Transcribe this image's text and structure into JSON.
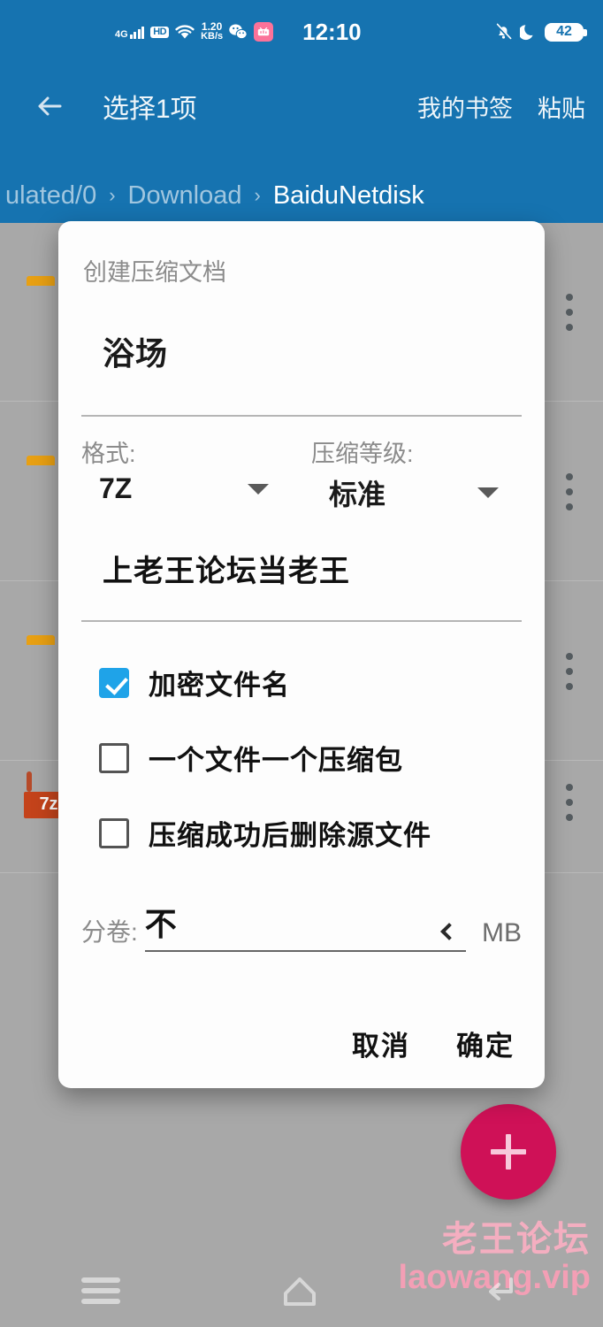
{
  "statusbar": {
    "network_label": "4G",
    "hd_label": "HD",
    "speed_value": "1.20",
    "speed_unit": "KB/s",
    "icons": [
      "signal-4g-icon",
      "hd-icon",
      "wifi-icon",
      "network-speed",
      "wechat-icon",
      "bilibili-icon"
    ],
    "time": "12:10",
    "right_icons": [
      "bell-muted-icon",
      "moon-dnd-icon"
    ],
    "battery_level": "42"
  },
  "toolbar": {
    "back_icon": "back-arrow-icon",
    "title": "选择1项",
    "actions": [
      {
        "label": "我的书签"
      },
      {
        "label": "粘贴"
      }
    ]
  },
  "breadcrumb": {
    "separator": "›",
    "items": [
      {
        "label": "ulated/0",
        "current": false
      },
      {
        "label": "Download",
        "current": false
      },
      {
        "label": "BaiduNetdisk",
        "current": true
      }
    ]
  },
  "filelist": {
    "rows": [
      {
        "icon": "folder-icon",
        "menu": "overflow-menu-icon"
      },
      {
        "icon": "folder-icon",
        "menu": "overflow-menu-icon"
      },
      {
        "icon": "folder-icon",
        "menu": "overflow-menu-icon"
      },
      {
        "icon": "sevenzip-file-icon",
        "menu": "overflow-menu-icon",
        "icon_label": "7z"
      }
    ]
  },
  "fab": {
    "icon": "plus-icon",
    "color": "#cf1157"
  },
  "watermark": {
    "line1": "老王论坛",
    "line2": "laowang.vip",
    "color": "#f4aec0"
  },
  "navbar": {
    "items": [
      {
        "name": "recents-button",
        "icon": "menu-hamburger-icon"
      },
      {
        "name": "home-button",
        "icon": "home-icon"
      },
      {
        "name": "back-button",
        "icon": "back-return-icon"
      }
    ]
  },
  "dialog": {
    "title": "创建压缩文档",
    "archive_name": "浴场",
    "format": {
      "label": "格式:",
      "value": "7Z",
      "caret": "chevron-down-icon"
    },
    "level": {
      "label": "压缩等级:",
      "value": "标准",
      "caret": "chevron-down-icon"
    },
    "password": "上老王论坛当老王",
    "checkboxes": [
      {
        "label": "加密文件名",
        "checked": true
      },
      {
        "label": "一个文件一个压缩包",
        "checked": false
      },
      {
        "label": "压缩成功后删除源文件",
        "checked": false
      }
    ],
    "split": {
      "label": "分卷:",
      "value": "不",
      "chevron": "chevron-left-icon",
      "unit": "MB"
    },
    "cancel_label": "取消",
    "confirm_label": "确定",
    "accent_checkbox_color": "#1fa3e8"
  },
  "colors": {
    "header_blue": "#1673b0",
    "scrim_gray": "#a8a8a8",
    "fab_pink": "#cf1157",
    "folder_yellow": "#d9a213",
    "sevenz_red": "#c4431b"
  }
}
